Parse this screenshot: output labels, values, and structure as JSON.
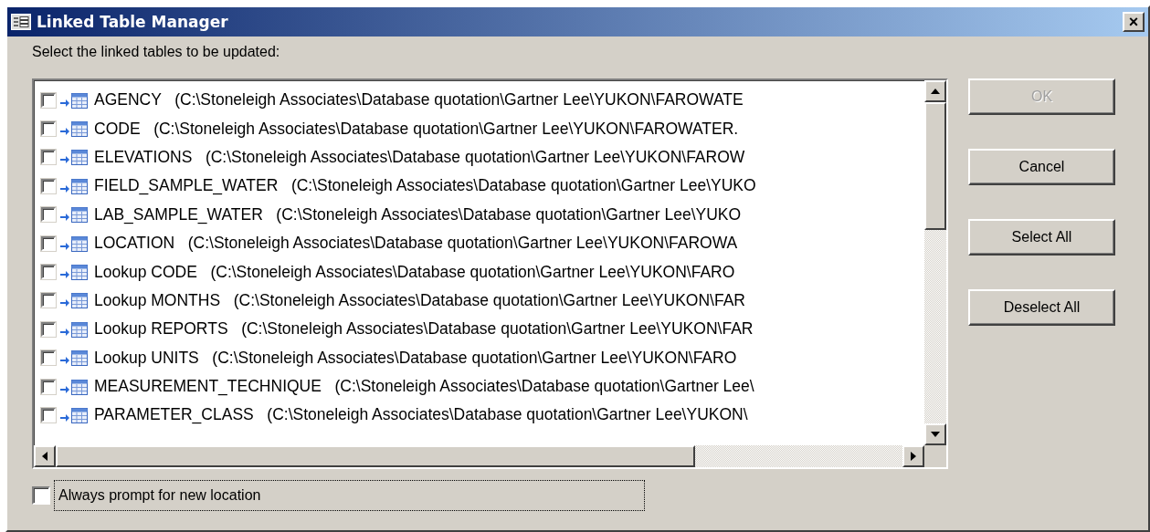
{
  "window": {
    "title": "Linked Table Manager",
    "close": "×"
  },
  "prompt": {
    "label": "Select the linked tables to be updated:"
  },
  "tables": [
    {
      "label": "AGENCY   (C:\\Stoneleigh Associates\\Database quotation\\Gartner Lee\\YUKON\\FAROWATE",
      "checked": false
    },
    {
      "label": "CODE   (C:\\Stoneleigh Associates\\Database quotation\\Gartner Lee\\YUKON\\FAROWATER.",
      "checked": false
    },
    {
      "label": "ELEVATIONS   (C:\\Stoneleigh Associates\\Database quotation\\Gartner Lee\\YUKON\\FAROW",
      "checked": false
    },
    {
      "label": "FIELD_SAMPLE_WATER   (C:\\Stoneleigh Associates\\Database quotation\\Gartner Lee\\YUKO",
      "checked": false
    },
    {
      "label": "LAB_SAMPLE_WATER   (C:\\Stoneleigh Associates\\Database quotation\\Gartner Lee\\YUKO",
      "checked": false
    },
    {
      "label": "LOCATION   (C:\\Stoneleigh Associates\\Database quotation\\Gartner Lee\\YUKON\\FAROWA",
      "checked": false
    },
    {
      "label": "Lookup CODE   (C:\\Stoneleigh Associates\\Database quotation\\Gartner Lee\\YUKON\\FARO",
      "checked": false
    },
    {
      "label": "Lookup MONTHS   (C:\\Stoneleigh Associates\\Database quotation\\Gartner Lee\\YUKON\\FAR",
      "checked": false
    },
    {
      "label": "Lookup REPORTS   (C:\\Stoneleigh Associates\\Database quotation\\Gartner Lee\\YUKON\\FAR",
      "checked": false
    },
    {
      "label": "Lookup UNITS   (C:\\Stoneleigh Associates\\Database quotation\\Gartner Lee\\YUKON\\FARO",
      "checked": false
    },
    {
      "label": "MEASUREMENT_TECHNIQUE   (C:\\Stoneleigh Associates\\Database quotation\\Gartner Lee\\",
      "checked": false
    },
    {
      "label": "PARAMETER_CLASS   (C:\\Stoneleigh Associates\\Database quotation\\Gartner Lee\\YUKON\\",
      "checked": false
    }
  ],
  "buttons": [
    {
      "label": "OK",
      "disabled": true
    },
    {
      "label": "Cancel",
      "disabled": false
    },
    {
      "label": "Select All",
      "disabled": false
    },
    {
      "label": "Deselect All",
      "disabled": false
    }
  ],
  "always_prompt": {
    "label": "Always prompt for new location",
    "checked": false,
    "focused": true
  }
}
